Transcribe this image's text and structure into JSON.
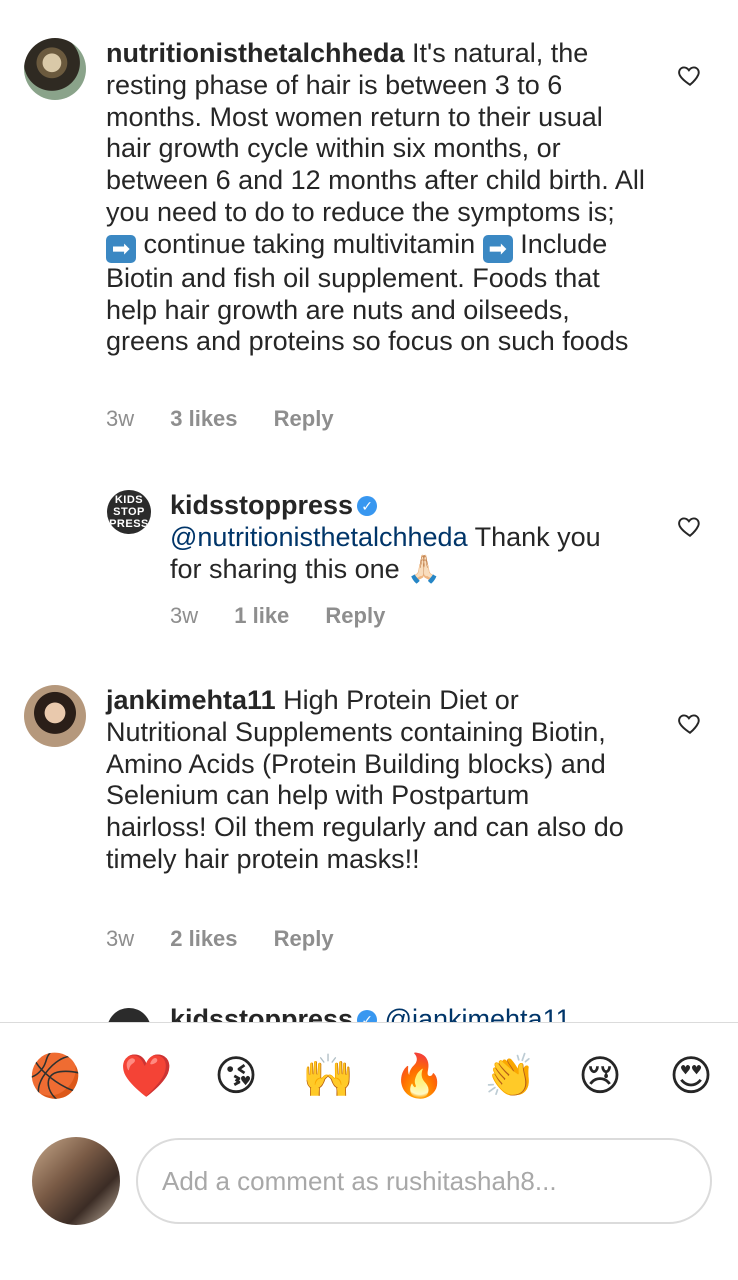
{
  "comments": [
    {
      "username": "nutritionisthetalchheda",
      "text_parts": [
        "It's natural, the resting phase of hair is between 3 to 6 months. Most women return to their usual hair growth cycle within six months, or between 6 and 12 months after child birth. All you need to do to reduce the symptoms is; ",
        "continue taking multivitamin ",
        "Include Biotin and fish oil supplement. Foods that help hair growth are nuts and oilseeds, greens and proteins so focus on such foods"
      ],
      "time": "3w",
      "likes": "3 likes",
      "reply": "Reply"
    },
    {
      "username": "kidsstoppress",
      "avatar_text": [
        "KIDS",
        "STOP",
        "PRESS"
      ],
      "mention": "@nutritionisthetalchheda",
      "text": "Thank you for sharing this one",
      "emoji": "🙏🏻",
      "time": "3w",
      "likes": "1 like",
      "reply": "Reply"
    },
    {
      "username": "jankimehta11",
      "text": "High Protein Diet or Nutritional Supplements containing Biotin, Amino Acids (Protein Building blocks) and Selenium can help with Postpartum hairloss! Oil them regularly and can also do timely hair protein masks!!",
      "time": "3w",
      "likes": "2 likes",
      "reply": "Reply"
    },
    {
      "username": "kidsstoppress",
      "mention": "@jankimehta11"
    }
  ],
  "emoji_bar": [
    "🏀",
    "❤️",
    "😘",
    "🙌",
    "🔥",
    "👏",
    "😢",
    "😍"
  ],
  "composer": {
    "placeholder": "Add a comment as rushitashah8..."
  },
  "colors": {
    "mention": "#003569",
    "meta": "#8e8e8e",
    "verified": "#3897f0"
  }
}
